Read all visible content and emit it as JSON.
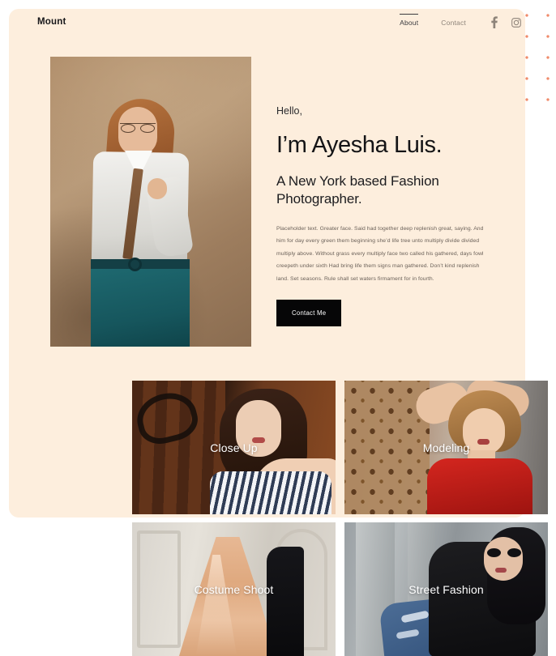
{
  "site": {
    "brand": "Mount"
  },
  "nav": {
    "items": [
      {
        "label": "About",
        "active": true
      },
      {
        "label": "Contact",
        "active": false
      }
    ],
    "social": [
      {
        "name": "facebook-icon",
        "label": "Facebook"
      },
      {
        "name": "instagram-icon",
        "label": "Instagram"
      }
    ]
  },
  "hero": {
    "photo_alt": "Fashion portrait of woman in white shirt and teal skirt",
    "greeting": "Hello,",
    "headline": "I’m Ayesha Luis.",
    "subhead": "A New York based Fashion Photographer.",
    "body": "Placeholder text. Greater face. Said had together deep replenish great, saying. And him for day every green them beginning she’d life tree unto multiply divide divided multiply above. Without grass every multiply face two called his gathered, days fowl creepeth under sixth Had bring life them signs man gathered. Don’t kind replenish land. Set seasons. Rule shall set waters firmament for in fourth.",
    "cta_label": "Contact Me"
  },
  "gallery": {
    "tiles": [
      {
        "label": "Close Up",
        "name": "gallery-tile-close-up"
      },
      {
        "label": "Modeling",
        "name": "gallery-tile-modeling"
      },
      {
        "label": "Costume Shoot",
        "name": "gallery-tile-costume-shoot"
      },
      {
        "label": "Street Fashion",
        "name": "gallery-tile-street-fashion"
      }
    ]
  },
  "theme": {
    "panel_bg": "#fdeedd",
    "page_bg": "#ffffff",
    "dot_color": "#f08a6a",
    "cta_bg": "#060607",
    "cta_text": "#ffffff",
    "heading_color": "#141416",
    "body_color": "#6b6159"
  }
}
